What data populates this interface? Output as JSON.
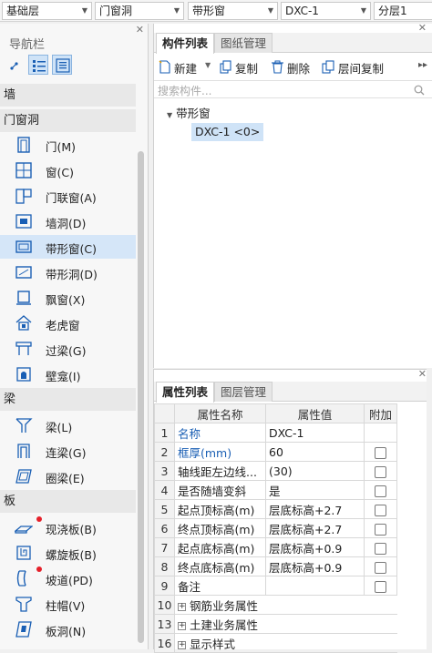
{
  "top_selectors": [
    {
      "value": "基础层"
    },
    {
      "value": "门窗洞"
    },
    {
      "value": "带形窗"
    },
    {
      "value": "DXC-1"
    },
    {
      "value": "分层1"
    }
  ],
  "nav": {
    "title": "导航栏",
    "categories": {
      "wall": "墙",
      "door_window": "门窗洞",
      "beam": "梁",
      "slab": "板"
    },
    "door_window_items": [
      {
        "label": "门(M)",
        "icon": "door-icon"
      },
      {
        "label": "窗(C)",
        "icon": "window-icon"
      },
      {
        "label": "门联窗(A)",
        "icon": "door-window-icon"
      },
      {
        "label": "墙洞(D)",
        "icon": "wall-opening-icon"
      },
      {
        "label": "带形窗(C)",
        "icon": "strip-window-icon"
      },
      {
        "label": "带形洞(D)",
        "icon": "strip-opening-icon"
      },
      {
        "label": "飘窗(X)",
        "icon": "bay-window-icon"
      },
      {
        "label": "老虎窗",
        "icon": "dormer-window-icon"
      },
      {
        "label": "过梁(G)",
        "icon": "lintel-icon"
      },
      {
        "label": "壁龛(I)",
        "icon": "niche-icon"
      }
    ],
    "beam_items": [
      {
        "label": "梁(L)",
        "icon": "beam-icon"
      },
      {
        "label": "连梁(G)",
        "icon": "coupling-beam-icon"
      },
      {
        "label": "圈梁(E)",
        "icon": "ring-beam-icon"
      }
    ],
    "slab_items": [
      {
        "label": "现浇板(B)",
        "icon": "cast-slab-icon"
      },
      {
        "label": "螺旋板(B)",
        "icon": "spiral-slab-icon"
      },
      {
        "label": "坡道(PD)",
        "icon": "ramp-icon"
      },
      {
        "label": "柱帽(V)",
        "icon": "column-cap-icon"
      },
      {
        "label": "板洞(N)",
        "icon": "slab-opening-icon"
      }
    ]
  },
  "component_panel": {
    "tabs": [
      "构件列表",
      "图纸管理"
    ],
    "toolbar": {
      "new": "新建",
      "copy": "复制",
      "delete": "删除",
      "floor_copy": "层间复制"
    },
    "search_placeholder": "搜索构件...",
    "tree": {
      "root": "带形窗",
      "node": "DXC-1 <0>"
    }
  },
  "property_panel": {
    "tabs": [
      "属性列表",
      "图层管理"
    ],
    "headers": {
      "name": "属性名称",
      "value": "属性值",
      "add": "附加"
    },
    "rows": [
      {
        "num": "1",
        "name": "名称",
        "value": "DXC-1",
        "checkbox": false
      },
      {
        "num": "2",
        "name": "框厚(mm)",
        "value": "60",
        "checkbox": true
      },
      {
        "num": "3",
        "name": "轴线距左边线...",
        "value": "(30)",
        "checkbox": true
      },
      {
        "num": "4",
        "name": "是否随墙变斜",
        "value": "是",
        "checkbox": true
      },
      {
        "num": "5",
        "name": "起点顶标高(m)",
        "value": "层底标高+2.7",
        "checkbox": true
      },
      {
        "num": "6",
        "name": "终点顶标高(m)",
        "value": "层底标高+2.7",
        "checkbox": true
      },
      {
        "num": "7",
        "name": "起点底标高(m)",
        "value": "层底标高+0.9",
        "checkbox": true
      },
      {
        "num": "8",
        "name": "终点底标高(m)",
        "value": "层底标高+0.9",
        "checkbox": true
      },
      {
        "num": "9",
        "name": "备注",
        "value": "",
        "checkbox": true
      }
    ],
    "groups": [
      {
        "num": "10",
        "name": "钢筋业务属性"
      },
      {
        "num": "13",
        "name": "土建业务属性"
      },
      {
        "num": "16",
        "name": "显示样式"
      }
    ]
  },
  "colors": {
    "accent": "#1a5fb4",
    "selection": "#cfe3f7",
    "red_dot": "#e5202a"
  }
}
